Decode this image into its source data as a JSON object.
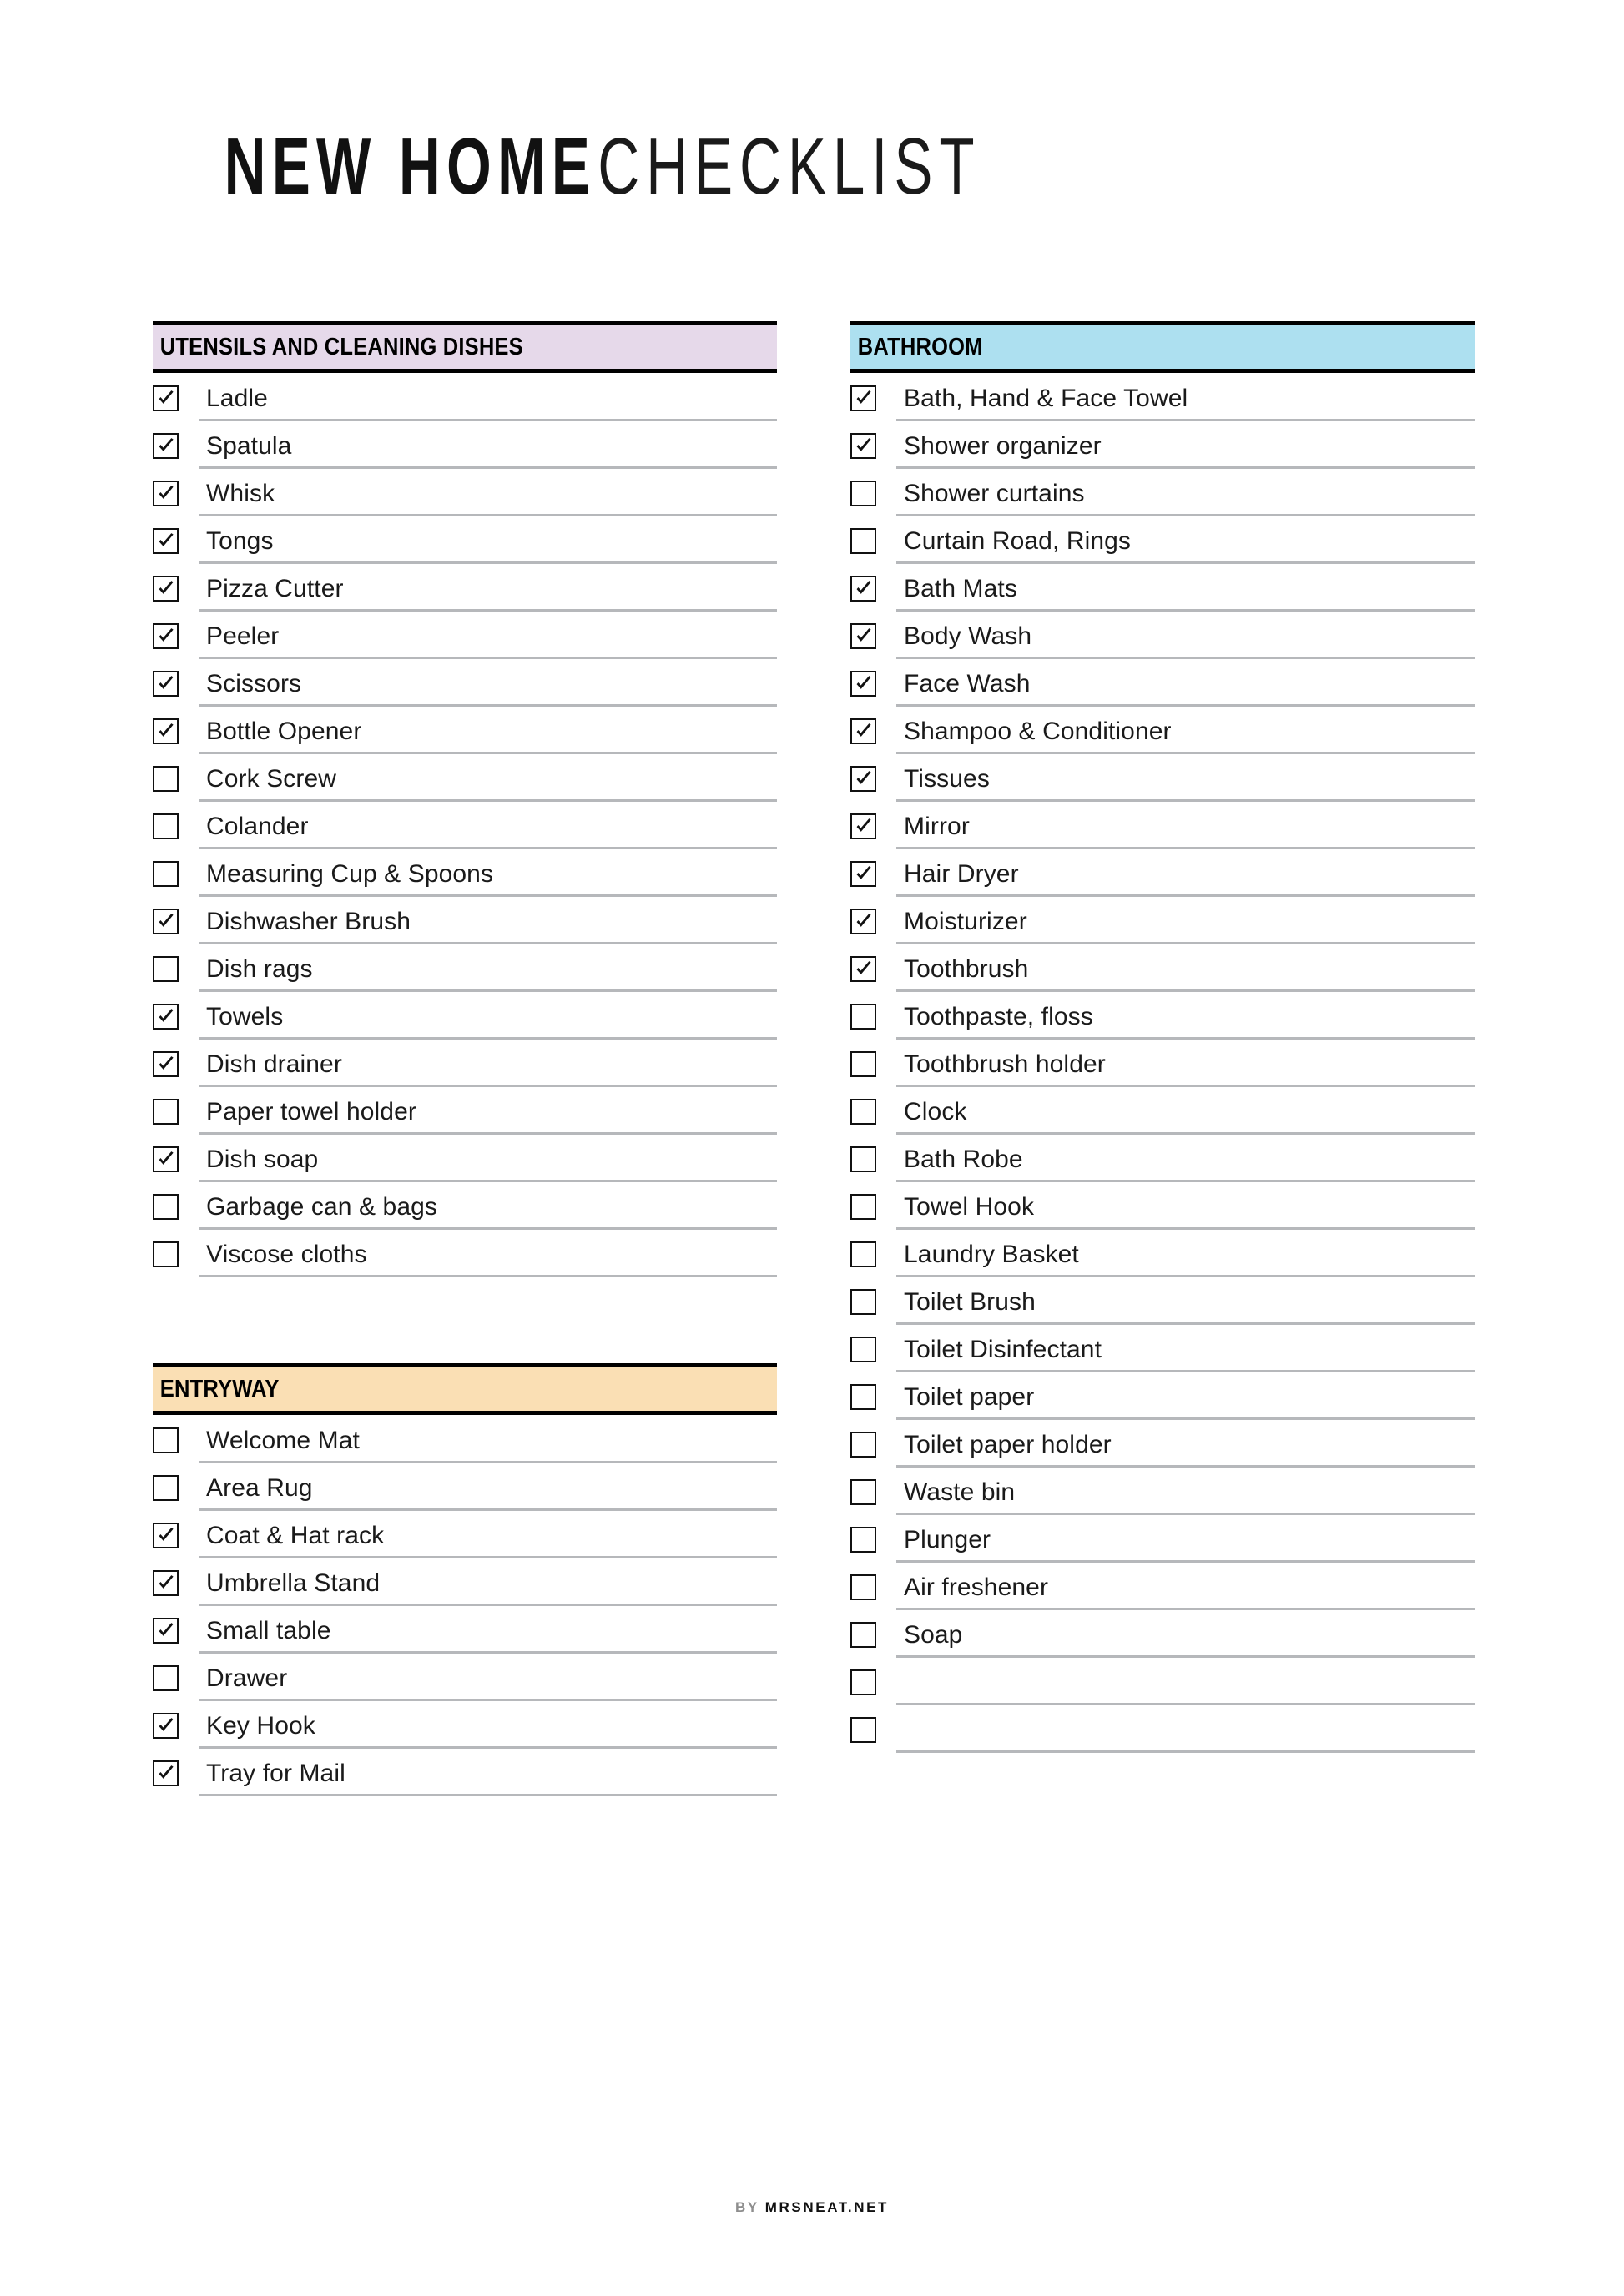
{
  "document": {
    "title_bold": "NEW HOME",
    "title_light": "CHECKLIST"
  },
  "footer": {
    "by_label": "BY",
    "site_label": "MRSNEAT.NET"
  },
  "colors": {
    "utensils_header_bg": "#e6d9ea",
    "bathroom_header_bg": "#ade0f0",
    "entryway_header_bg": "#fadfb4",
    "header_border": "#000000",
    "row_rule": "#b6b8bb",
    "text": "#1a1a1a",
    "footer_by": "#8e8e8e"
  },
  "sections": [
    {
      "id": "utensils",
      "column": "left",
      "title": "UTENSILS AND CLEANING DISHES",
      "header_color": "#e6d9ea",
      "items": [
        {
          "label": "Ladle",
          "checked": true
        },
        {
          "label": "Spatula",
          "checked": true
        },
        {
          "label": "Whisk",
          "checked": true
        },
        {
          "label": "Tongs",
          "checked": true
        },
        {
          "label": "Pizza Cutter",
          "checked": true
        },
        {
          "label": "Peeler",
          "checked": true
        },
        {
          "label": "Scissors",
          "checked": true
        },
        {
          "label": "Bottle Opener",
          "checked": true
        },
        {
          "label": "Cork Screw",
          "checked": false
        },
        {
          "label": "Colander",
          "checked": false
        },
        {
          "label": "Measuring Cup & Spoons",
          "checked": false
        },
        {
          "label": "Dishwasher Brush",
          "checked": true
        },
        {
          "label": "Dish rags",
          "checked": false
        },
        {
          "label": "Towels",
          "checked": true
        },
        {
          "label": "Dish drainer",
          "checked": true
        },
        {
          "label": "Paper towel holder",
          "checked": false
        },
        {
          "label": "Dish soap",
          "checked": true
        },
        {
          "label": "Garbage can & bags",
          "checked": false
        },
        {
          "label": "Viscose cloths",
          "checked": false
        }
      ]
    },
    {
      "id": "entryway",
      "column": "left",
      "title": "ENTRYWAY",
      "header_color": "#fadfb4",
      "items": [
        {
          "label": "Welcome Mat",
          "checked": false
        },
        {
          "label": "Area Rug",
          "checked": false
        },
        {
          "label": "Coat & Hat rack",
          "checked": true
        },
        {
          "label": "Umbrella Stand",
          "checked": true
        },
        {
          "label": "Small table",
          "checked": true
        },
        {
          "label": "Drawer",
          "checked": false
        },
        {
          "label": "Key Hook",
          "checked": true
        },
        {
          "label": "Tray for Mail",
          "checked": true
        }
      ]
    },
    {
      "id": "bathroom",
      "column": "right",
      "title": "BATHROOM",
      "header_color": "#ade0f0",
      "items": [
        {
          "label": "Bath, Hand & Face Towel",
          "checked": true
        },
        {
          "label": "Shower organizer",
          "checked": true
        },
        {
          "label": "Shower curtains",
          "checked": false
        },
        {
          "label": "Curtain Road, Rings",
          "checked": false
        },
        {
          "label": "Bath Mats",
          "checked": true
        },
        {
          "label": "Body Wash",
          "checked": true
        },
        {
          "label": "Face Wash",
          "checked": true
        },
        {
          "label": "Shampoo & Conditioner",
          "checked": true
        },
        {
          "label": "Tissues",
          "checked": true
        },
        {
          "label": "Mirror",
          "checked": true
        },
        {
          "label": "Hair Dryer",
          "checked": true
        },
        {
          "label": "Moisturizer",
          "checked": true
        },
        {
          "label": "Toothbrush",
          "checked": true
        },
        {
          "label": "Toothpaste, floss",
          "checked": false
        },
        {
          "label": "Toothbrush holder",
          "checked": false
        },
        {
          "label": "Clock",
          "checked": false
        },
        {
          "label": "Bath Robe",
          "checked": false
        },
        {
          "label": "Towel Hook",
          "checked": false
        },
        {
          "label": "Laundry Basket",
          "checked": false
        },
        {
          "label": "Toilet Brush",
          "checked": false
        },
        {
          "label": "Toilet Disinfectant",
          "checked": false
        },
        {
          "label": "Toilet paper",
          "checked": false
        },
        {
          "label": "Toilet paper holder",
          "checked": false
        },
        {
          "label": "Waste bin",
          "checked": false
        },
        {
          "label": "Plunger",
          "checked": false
        },
        {
          "label": "Air freshener",
          "checked": false
        },
        {
          "label": "Soap",
          "checked": false
        },
        {
          "label": "",
          "checked": false
        },
        {
          "label": "",
          "checked": false
        }
      ]
    }
  ]
}
